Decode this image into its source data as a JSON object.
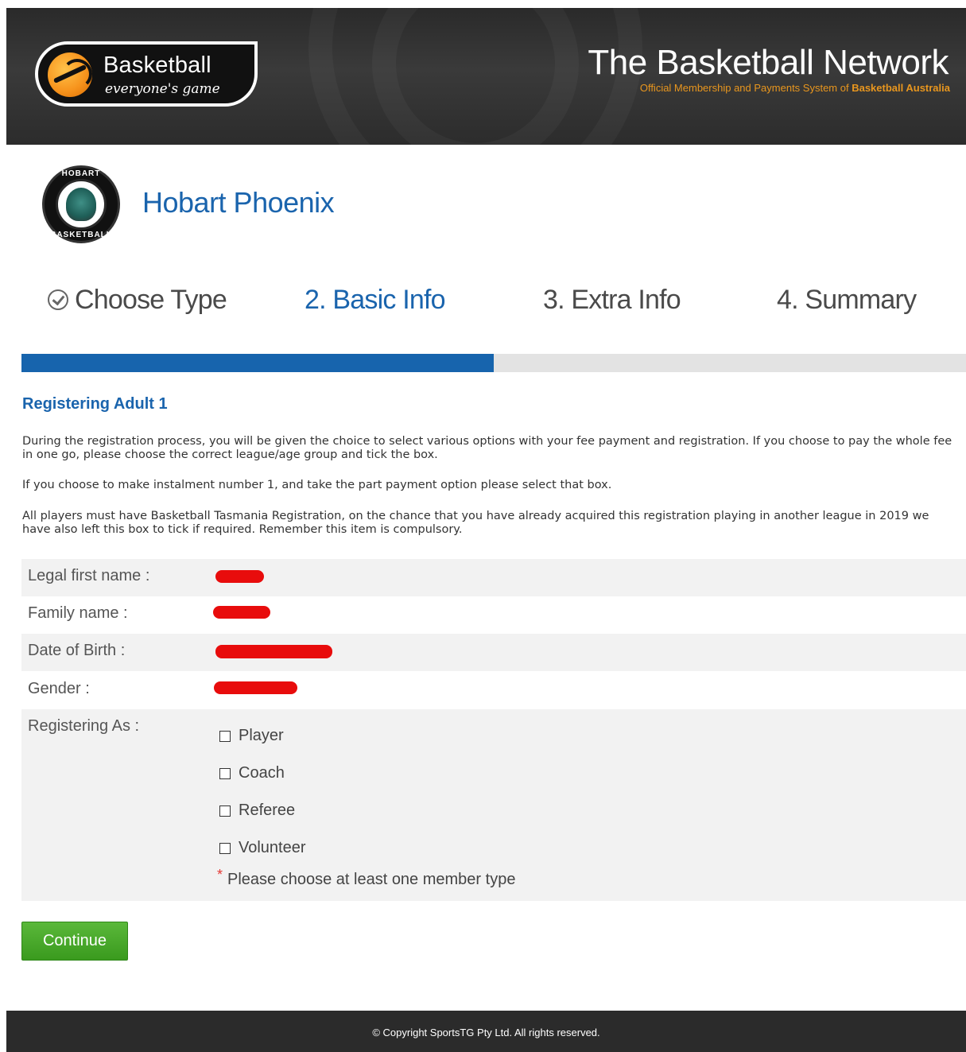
{
  "header": {
    "logo_main": "Basketball",
    "logo_sub": "everyone's game",
    "network_title": "The Basketball Network",
    "network_sub_prefix": "Official Membership and Payments System of ",
    "network_sub_strong": "Basketball Australia"
  },
  "club": {
    "logo_top": "HOBART",
    "logo_bottom": "BASKETBALL",
    "name": "Hobart Phoenix"
  },
  "steps": [
    {
      "label": "Choose Type",
      "state": "done"
    },
    {
      "label": "2. Basic Info",
      "state": "active"
    },
    {
      "label": "3. Extra Info",
      "state": "pending"
    },
    {
      "label": "4. Summary",
      "state": "pending"
    }
  ],
  "progress": {
    "fraction": 0.5,
    "fill_color": "#1764ad",
    "track_color": "#e3e3e3"
  },
  "intro": {
    "heading": "Registering Adult 1",
    "para1": "During the registration process, you will be given the choice to select various options with your fee payment and registration. If you choose to pay the whole fee in one go, please choose the correct league/age group and tick the box.",
    "para2": "If you choose to make instalment number 1, and take the part payment option please select that box.",
    "para3": "All players must have Basketball Tasmania Registration, on the chance that you have already acquired this registration playing in another league in 2019 we have also left this box to tick if required. Remember this item is compulsory."
  },
  "form": {
    "fields": [
      {
        "label": "Legal first name :"
      },
      {
        "label": "Family name :"
      },
      {
        "label": "Date of Birth :"
      },
      {
        "label": "Gender :"
      }
    ],
    "registering_as_label": "Registering As :",
    "options": [
      "Player",
      "Coach",
      "Referee",
      "Volunteer"
    ],
    "required_hint": "Please choose at least one member type",
    "required_marker": "*"
  },
  "actions": {
    "continue_label": "Continue"
  },
  "footer": {
    "copyright": "©  Copyright SportsTG Pty Ltd. All rights reserved."
  },
  "colors": {
    "brand_blue": "#1a64ad",
    "accent_orange": "#e8961e",
    "continue_green": "#3a9a1e",
    "redaction_red": "#e80c0c"
  }
}
